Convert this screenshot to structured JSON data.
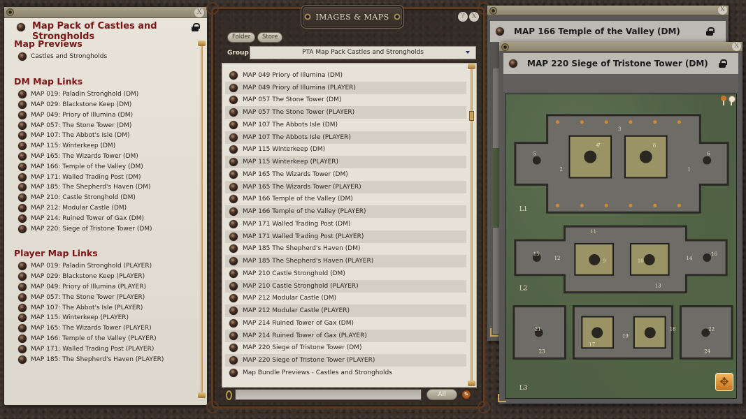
{
  "story": {
    "title": "Map Pack of Castles and Strongholds",
    "close_glyph": "X",
    "sections": {
      "previews": {
        "heading": "Map Previews",
        "items": [
          "Castles and Strongholds"
        ]
      },
      "dm": {
        "heading": "DM Map Links",
        "items": [
          "MAP 019: Paladin Stronghold (DM)",
          "MAP 029: Blackstone Keep (DM)",
          "MAP 049: Priory of Illumina (DM)",
          "MAP 057: The Stone Tower (DM)",
          "MAP 107: The Abbot's Isle (DM)",
          "MAP 115: Winterkeep (DM)",
          "MAP 165: The Wizards Tower (DM)",
          "MAP 166: Temple of the Valley (DM)",
          "MAP 171: Walled Trading Post (DM)",
          "MAP 185: The Shepherd's Haven (DM)",
          "MAP 210: Castle Stronghold (DM)",
          "MAP 212: Modular Castle (DM)",
          "MAP 214: Ruined Tower of Gax (DM)",
          "MAP 220: Siege of Tristone Tower (DM)"
        ]
      },
      "player": {
        "heading": "Player Map Links",
        "items": [
          "MAP 019: Paladin Stronghold (PLAYER)",
          "MAP 029: Blackstone Keep (PLAYER)",
          "MAP 049: Priory of Illumina (PLAYER)",
          "MAP 057: The Stone Tower (PLAYER)",
          "MAP 107: The Abbot's Isle (PLAYER)",
          "MAP 115: Winterkeep (PLAYER)",
          "MAP 165: The Wizards Tower (PLAYER)",
          "MAP 166: Temple of the Valley (PLAYER)",
          "MAP 171: Walled Trading Post (PLAYER)",
          "MAP 185: The Shepherd's Haven (PLAYER)"
        ]
      }
    }
  },
  "library": {
    "title": "IMAGES & MAPS",
    "help_glyph": "?",
    "close_glyph": "X",
    "buttons": {
      "folder": "Folder",
      "store": "Store",
      "all": "All",
      "edit_glyph": "✎"
    },
    "group_label": "Group",
    "group_value": "PTA Map Pack Castles and Strongholds",
    "search_value": "",
    "items": [
      "MAP 049 Priory of Illumina (DM)",
      "MAP 049 Priory of Illumina (PLAYER)",
      "MAP 057 The Stone Tower (DM)",
      "MAP 057 The Stone Tower (PLAYER)",
      "MAP 107 The Abbots Isle (DM)",
      "MAP 107 The Abbots Isle (PLAYER)",
      "MAP 115 Winterkeep (DM)",
      "MAP 115 Winterkeep (PLAYER)",
      "MAP 165 The Wizards Tower (DM)",
      "MAP 165 The Wizards Tower (PLAYER)",
      "MAP 166 Temple of the Valley (DM)",
      "MAP 166 Temple of the Valley (PLAYER)",
      "MAP 171 Walled Trading Post (DM)",
      "MAP 171 Walled Trading Post (PLAYER)",
      "MAP 185 The Shepherd's Haven (DM)",
      "MAP 185 The Shepherd's Haven (PLAYER)",
      "MAP 210 Castle Stronghold (DM)",
      "MAP 210 Castle Stronghold (PLAYER)",
      "MAP 212 Modular Castle (DM)",
      "MAP 212 Modular Castle (PLAYER)",
      "MAP 214 Ruined Tower of Gax (DM)",
      "MAP 214 Ruined Tower of Gax (PLAYER)",
      "MAP 220 Siege of Tristone Tower (DM)",
      "MAP 220 Siege of Tristone Tower (PLAYER)",
      "Map Bundle Previews - Castles and Strongholds"
    ]
  },
  "image_windows": [
    {
      "title": "MAP 166 Temple of the Valley (DM)",
      "close_glyph": "X"
    },
    {
      "title": "MAP 220 Siege of Tristone Tower (DM)",
      "close_glyph": "X",
      "map_labels": {
        "levels": [
          "L1",
          "L2",
          "L3"
        ],
        "rooms": [
          "1",
          "2",
          "3",
          "4",
          "5",
          "6",
          "7",
          "8",
          "9",
          "10",
          "11",
          "12",
          "13",
          "14",
          "15",
          "16",
          "17",
          "18",
          "19",
          "21",
          "22",
          "23",
          "24"
        ]
      },
      "expand_glyph": "✥"
    }
  ],
  "colors": {
    "heading_red": "#7b1616",
    "parchment": "#e6e2d8",
    "row_alt": "#d3cfc5",
    "accent_orange": "#c9742c",
    "map_green": "#4e5f44"
  }
}
